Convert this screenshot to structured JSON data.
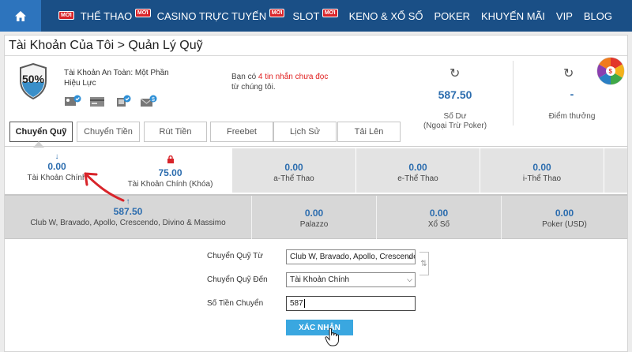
{
  "nav": {
    "items": [
      {
        "label": "THỂ THAO",
        "badge": "MỚI"
      },
      {
        "label": "CASINO TRỰC TUYẾN",
        "badge": "MỚI"
      },
      {
        "label": "SLOT",
        "badge": "MỚI"
      },
      {
        "label": "KENO & XỔ SỐ"
      },
      {
        "label": "POKER"
      },
      {
        "label": "KHUYẾN MÃI"
      },
      {
        "label": "VIP"
      },
      {
        "label": "BLOG"
      }
    ],
    "lead_badge": "MỚI",
    "home_icon": "home-icon"
  },
  "breadcrumb": "Tài Khoản Của Tôi > Quản Lý Quỹ",
  "security": {
    "percent": "50%",
    "text": "Tài Khoản An Toàn: Một Phần Hiệu Lực"
  },
  "message": {
    "prefix": "Bạn có ",
    "highlight": "4 tin nhắn chưa đọc",
    "suffix": "từ chúng tôi."
  },
  "balance": {
    "value": "587.50",
    "label_line1": "Số Dư",
    "label_line2": "(Ngoại Trừ Poker)"
  },
  "points": {
    "value": "-",
    "label": "Điểm thưởng"
  },
  "tabs": [
    "Chuyển Quỹ",
    "Chuyển Tiền",
    "Rút Tiền",
    "Freebet",
    "Lịch Sử",
    "Tải Lên"
  ],
  "wallets_row1": [
    {
      "value": "0.00",
      "label": "Tài Khoản Chính"
    },
    {
      "value": "75.00",
      "label": "Tài Khoản Chính (Khóa)"
    },
    {
      "value": "0.00",
      "label": "a-Thể Thao"
    },
    {
      "value": "0.00",
      "label": "e-Thể Thao"
    },
    {
      "value": "0.00",
      "label": "i-Thể Thao"
    }
  ],
  "wallets_row2": [
    {
      "value": "587.50",
      "label": "Club W, Bravado, Apollo, Crescendo, Divino & Massimo"
    },
    {
      "value": "0.00",
      "label": "Palazzo"
    },
    {
      "value": "0.00",
      "label": "Xổ Số"
    },
    {
      "value": "0.00",
      "label": "Poker (USD)"
    }
  ],
  "form": {
    "from_label": "Chuyển Quỹ Từ",
    "from_value": "Club W, Bravado, Apollo, Crescendo, Divino & Massimo",
    "to_label": "Chuyển Quỹ Đến",
    "to_value": "Tài Khoản Chính",
    "amount_label": "Số Tiền Chuyển",
    "amount_value": "587",
    "confirm_label": "XÁC NHẬN"
  },
  "colors": {
    "nav_bg": "#1a4f86",
    "home_bg": "#2d74bd",
    "accent_blue": "#2b6cae",
    "button": "#3aa7e0",
    "alert_red": "#e02020"
  }
}
